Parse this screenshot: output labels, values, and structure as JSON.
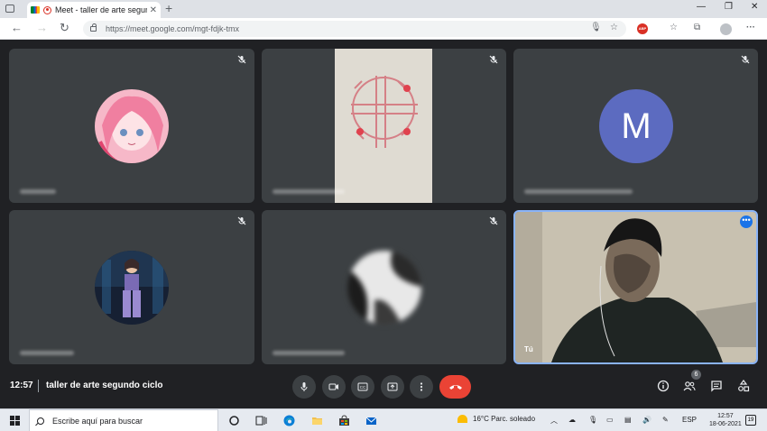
{
  "browser": {
    "tab_title": "Meet - taller de arte segundo",
    "url": "https://meet.google.com/mgt-fdjk-tmx",
    "adblock_label": "ABP"
  },
  "meeting": {
    "tiles": [
      {
        "kind": "avatar-image",
        "muted": true
      },
      {
        "kind": "video",
        "muted": true
      },
      {
        "kind": "avatar-letter",
        "letter": "M",
        "muted": true
      },
      {
        "kind": "avatar-image",
        "muted": true
      },
      {
        "kind": "avatar-image",
        "muted": true
      },
      {
        "kind": "self-video",
        "label": "Tú"
      }
    ],
    "self_more_label": "•••"
  },
  "bottombar": {
    "time": "12:57",
    "meeting_name": "taller de arte segundo ciclo",
    "participants_count": "6"
  },
  "taskbar": {
    "search_placeholder": "Escribe aquí para buscar",
    "weather": "16°C  Parc. soleado",
    "language": "ESP",
    "clock_time": "12:57",
    "clock_date": "18-06-2021",
    "notification_count": "19"
  },
  "colors": {
    "tile_bg": "#3c4043",
    "stage_bg": "#202124",
    "leave_red": "#ea4335",
    "letter_avatar": "#5c6bc0",
    "self_border": "#8ab4f8"
  }
}
